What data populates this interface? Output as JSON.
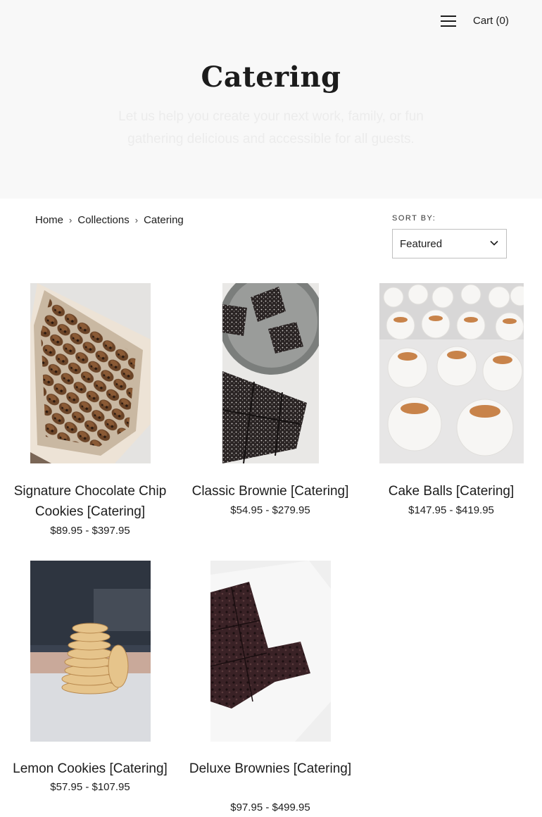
{
  "header": {
    "cart_label": "Cart (0)"
  },
  "hero": {
    "title": "Catering",
    "description": "Let us help you create your next work, family, or fun gathering delicious and accessible for all guests."
  },
  "breadcrumb": {
    "items": [
      "Home",
      "Collections",
      "Catering"
    ],
    "separator": "›"
  },
  "sort": {
    "label": "SORT BY:",
    "selected": "Featured"
  },
  "products": [
    {
      "title": "Signature Chocolate Chip Cookies [Catering]",
      "price": "$89.95 - $397.95",
      "image": "cookies-in-box-photo"
    },
    {
      "title": "Classic Brownie [Catering]",
      "price": "$54.95 - $279.95",
      "image": "brownies-with-powdered-sugar-photo"
    },
    {
      "title": "Cake Balls [Catering]",
      "price": "$147.95 - $419.95",
      "image": "coconut-cake-balls-photo"
    },
    {
      "title": "Lemon Cookies [Catering]",
      "price": "$57.95 - $107.95",
      "image": "stacked-lemon-cookies-photo"
    },
    {
      "title": "Deluxe Brownies [Catering]",
      "price": "$97.95 - $499.95",
      "image": "chocolate-chip-brownies-photo"
    }
  ],
  "colors": {
    "text": "#1c1c1c",
    "hero_bg": "#f8f8f8",
    "border": "#bfbfbf"
  }
}
